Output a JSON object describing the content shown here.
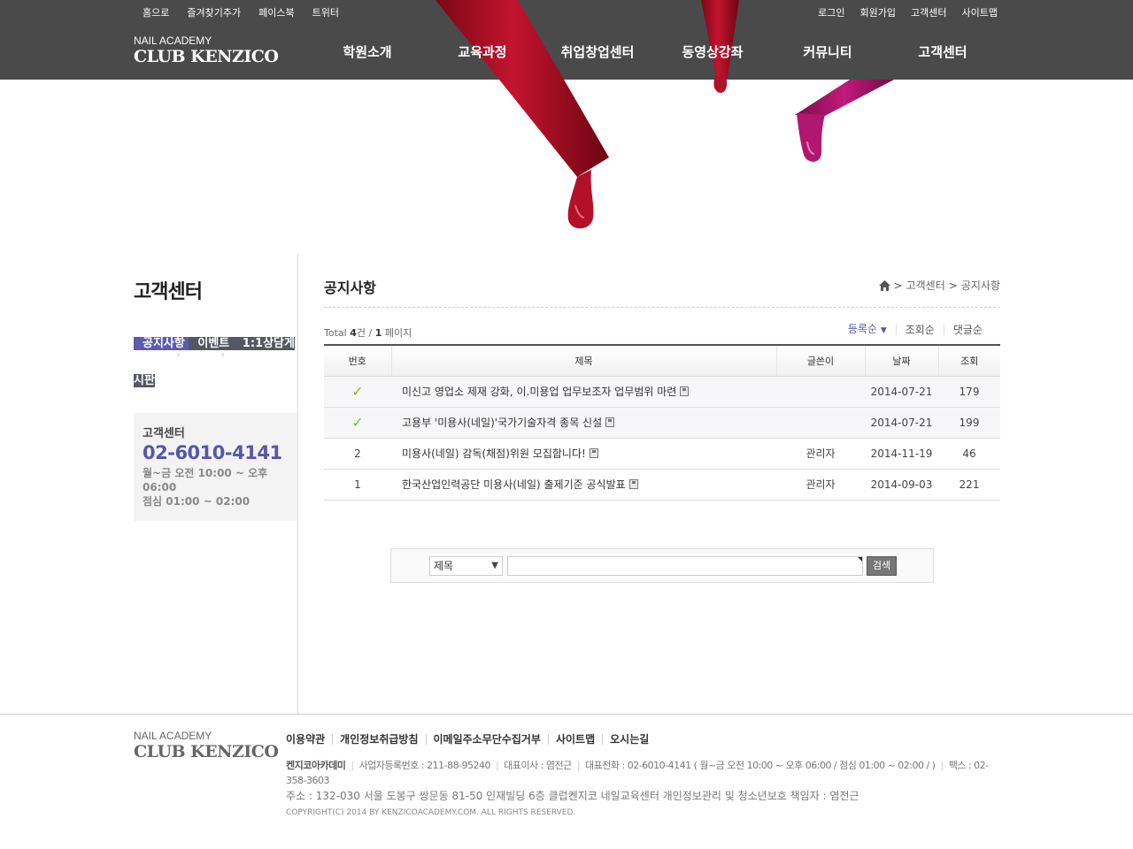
{
  "colors": {
    "header_bg": "#4a4a4a",
    "accent": "#5c5bb0",
    "side_menu_bg": "#545861",
    "check": "#7bbf2a",
    "drip_red": "#b3102a",
    "drip_magenta": "#b01770"
  },
  "top_links_left": [
    "홈으로",
    "즐겨찾기추가",
    "페이스북",
    "트위터"
  ],
  "top_links_right": [
    "로그인",
    "회원가입",
    "고객센터",
    "사이트맵"
  ],
  "logo": {
    "small": "NAIL ACADEMY",
    "big": "CLUB KENZICO"
  },
  "gnb": [
    "학원소개",
    "교육과정",
    "취업창업센터",
    "동영상강좌",
    "커뮤니티",
    "고객센터"
  ],
  "sidebar": {
    "title": "고객센터",
    "items": [
      {
        "label": "공지사항",
        "active": true
      },
      {
        "label": "이벤트",
        "active": false
      },
      {
        "label": "1:1상담게시판",
        "active": false
      }
    ],
    "contact": {
      "title": "고객센터",
      "phone": "02-6010-4141",
      "hours1": "월~금 오전 10:00 ~ 오후 06:00",
      "hours2": "점심 01:00 ~ 02:00"
    }
  },
  "content": {
    "title": "공지사항",
    "breadcrumb": [
      "고객센터",
      "공지사항"
    ],
    "total": {
      "prefix": "Total",
      "count": "4",
      "count_unit": "건",
      "slash": "/",
      "pages": "1",
      "pages_unit": "페이지"
    },
    "sort": [
      "등록순",
      "조회순",
      "댓글순"
    ],
    "columns": [
      "번호",
      "제목",
      "글쓴이",
      "날짜",
      "조회"
    ],
    "rows": [
      {
        "num": "",
        "notice": true,
        "subject": "미신고 영업소 제재 강화, 이.미용업 업무보조자 업무범위 마련",
        "writer": "",
        "date": "2014-07-21",
        "views": "179"
      },
      {
        "num": "",
        "notice": true,
        "subject": "고용부 '미용사(네일)'국가기술자격 종목 신설",
        "writer": "",
        "date": "2014-07-21",
        "views": "199"
      },
      {
        "num": "2",
        "notice": false,
        "subject": "미용사(네일) 감독(채점)위원 모집합니다!",
        "writer": "관리자",
        "date": "2014-11-19",
        "views": "46"
      },
      {
        "num": "1",
        "notice": false,
        "subject": "한국산업인력공단 미용사(네일) 출제기준 공식발표",
        "writer": "관리자",
        "date": "2014-09-03",
        "views": "221"
      }
    ]
  },
  "search": {
    "select_value": "제목",
    "input_value": "",
    "button": "검색"
  },
  "footer": {
    "logo": {
      "small": "NAIL ACADEMY",
      "big": "CLUB KENZICO"
    },
    "links": [
      "이용약관",
      "개인정보취급방침",
      "이메일주소무단수집거부",
      "사이트맵",
      "오시는길"
    ],
    "brand": "켄지코아카데미",
    "biz_no": "사업자등록번호 : 211-88-95240",
    "ceo": "대표이사 : 염전근",
    "phone": "대표전화 : 02-6010-4141 ( 월~금 오전 10:00 ~ 오후 06:00 / 점심 01:00 ~ 02:00 / )",
    "fax": "팩스 : 02-358-3603",
    "address": "주소 : 132-030 서울 도봉구 쌍문동 81-50 인재빌딩 6층 클럽켄지코 네일교육센터 개인정보관리 및 청소년보호 책임자 : 염전근",
    "copyright": "COPYRIGHT(C) 2014 BY KENZICOACADEMY.COM. ALL RIGHTS RESERVED."
  }
}
